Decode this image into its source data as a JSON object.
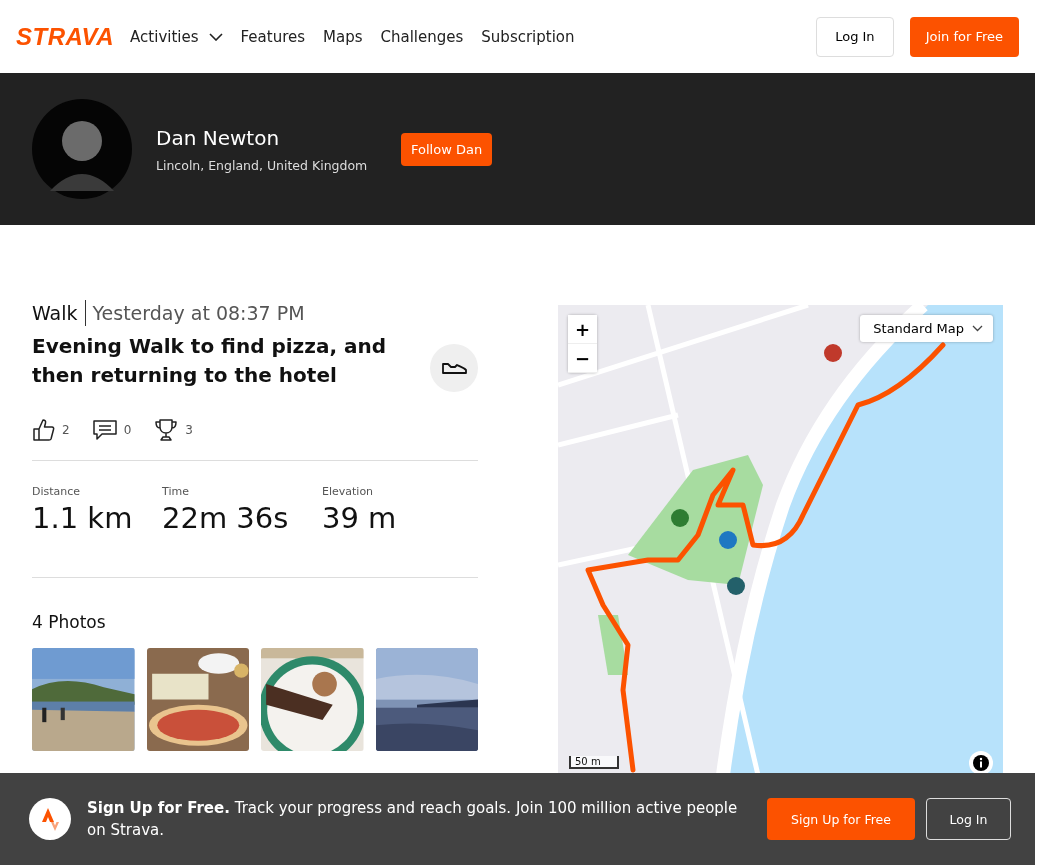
{
  "nav": {
    "logo": "STRAVA",
    "items": [
      {
        "label": "Activities",
        "dropdown": true
      },
      {
        "label": "Features",
        "dropdown": false
      },
      {
        "label": "Maps",
        "dropdown": false
      },
      {
        "label": "Challenges",
        "dropdown": false
      },
      {
        "label": "Subscription",
        "dropdown": false
      }
    ],
    "login": "Log In",
    "join": "Join for Free"
  },
  "profile": {
    "name": "Dan Newton",
    "location": "Lincoln, England, United Kingdom",
    "follow": "Follow Dan"
  },
  "activity": {
    "type": "Walk",
    "date": "Yesterday at 08:37 PM",
    "title": "Evening Walk to find pizza, and then returning to the hotel",
    "social": [
      {
        "kind": "kudos",
        "count": "2"
      },
      {
        "kind": "comments",
        "count": "0"
      },
      {
        "kind": "achievements",
        "count": "3"
      }
    ],
    "stats": [
      {
        "label": "Distance",
        "value": "1.1 km"
      },
      {
        "label": "Time",
        "value": "22m 36s"
      },
      {
        "label": "Elevation",
        "value": "39 m"
      }
    ],
    "photos_title": "4 Photos"
  },
  "map": {
    "zoom_in": "+",
    "zoom_out": "−",
    "style_select": "Standard Map",
    "scale": "50 m"
  },
  "banner": {
    "text": "**Sign Up for Free.** Track your progress and reach goals. Join 100 million active people on Strava.",
    "signup": "Sign Up for Free",
    "login": "Log In"
  }
}
